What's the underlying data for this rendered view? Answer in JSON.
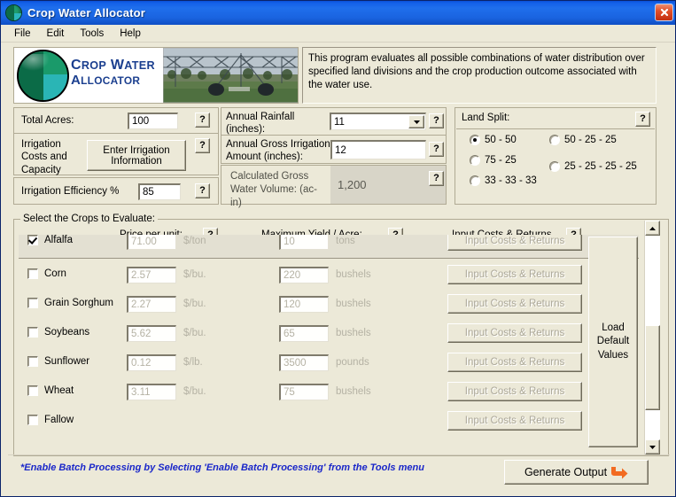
{
  "window": {
    "title": "Crop Water Allocator",
    "close_label": "✕"
  },
  "menu": {
    "items": [
      {
        "label": "File"
      },
      {
        "label": "Edit"
      },
      {
        "label": "Tools"
      },
      {
        "label": "Help"
      }
    ]
  },
  "banner": {
    "logo_line1": "Crop Water",
    "logo_line2": "Allocator",
    "photo_alt": "center-pivot-irrigation-photo"
  },
  "description": {
    "text": "This program evaluates all possible combinations of water distribution over specified land divisions and the crop production outcome associated with the water use."
  },
  "inputs": {
    "total_acres": {
      "label": "Total Acres:",
      "value": "100",
      "help": "?"
    },
    "irrigation_costs": {
      "label": "Irrigation Costs and Capacity",
      "button_label": "Enter Irrigation Information",
      "help": "?"
    },
    "irrigation_efficiency": {
      "label": "Irrigation Efficiency %",
      "value": "85",
      "help": "?"
    },
    "annual_rainfall": {
      "label": "Annual Rainfall (inches):",
      "value": "11",
      "help": "?"
    },
    "gross_irrigation": {
      "label": "Annual Gross Irrigation Amount (inches):",
      "value": "12",
      "help": "?"
    },
    "gross_water_volume": {
      "label": "Calculated Gross Water Volume: (ac-in)",
      "value": "1,200",
      "help": "?"
    }
  },
  "land_split": {
    "title": "Land Split:",
    "help": "?",
    "options": [
      {
        "label": "50 - 50",
        "selected": true
      },
      {
        "label": "75 - 25",
        "selected": false
      },
      {
        "label": "33 - 33 - 33",
        "selected": false
      },
      {
        "label": "50 - 25 - 25",
        "selected": false
      },
      {
        "label": "25 - 25 - 25 - 25",
        "selected": false
      }
    ]
  },
  "crops_panel": {
    "title": "Select the Crops to Evaluate:",
    "columns": {
      "price": "Price per unit:",
      "yield": "Maximum Yield / Acre:",
      "costs": "Input Costs & Returns"
    },
    "help": "?",
    "load_defaults_label": "Load Default Values",
    "rows": [
      {
        "name": "Alfalfa",
        "checked": true,
        "price": "71.00",
        "price_unit": "$/ton",
        "yield": "10",
        "yield_unit": "tons",
        "button": "Input Costs & Returns"
      },
      {
        "name": "Corn",
        "checked": false,
        "price": "2.57",
        "price_unit": "$/bu.",
        "yield": "220",
        "yield_unit": "bushels",
        "button": "Input Costs & Returns"
      },
      {
        "name": "Grain Sorghum",
        "checked": false,
        "price": "2.27",
        "price_unit": "$/bu.",
        "yield": "120",
        "yield_unit": "bushels",
        "button": "Input Costs & Returns"
      },
      {
        "name": "Soybeans",
        "checked": false,
        "price": "5.62",
        "price_unit": "$/bu.",
        "yield": "65",
        "yield_unit": "bushels",
        "button": "Input Costs & Returns"
      },
      {
        "name": "Sunflower",
        "checked": false,
        "price": "0.12",
        "price_unit": "$/lb.",
        "yield": "3500",
        "yield_unit": "pounds",
        "button": "Input Costs & Returns"
      },
      {
        "name": "Wheat",
        "checked": false,
        "price": "3.11",
        "price_unit": "$/bu.",
        "yield": "75",
        "yield_unit": "bushels",
        "button": "Input Costs & Returns"
      },
      {
        "name": "Fallow",
        "checked": false,
        "price": "",
        "price_unit": "",
        "yield": "",
        "yield_unit": "",
        "button": "Input Costs & Returns"
      }
    ]
  },
  "footer": {
    "note": "*Enable Batch Processing by Selecting 'Enable Batch Processing' from the Tools menu",
    "generate_label": "Generate Output"
  }
}
